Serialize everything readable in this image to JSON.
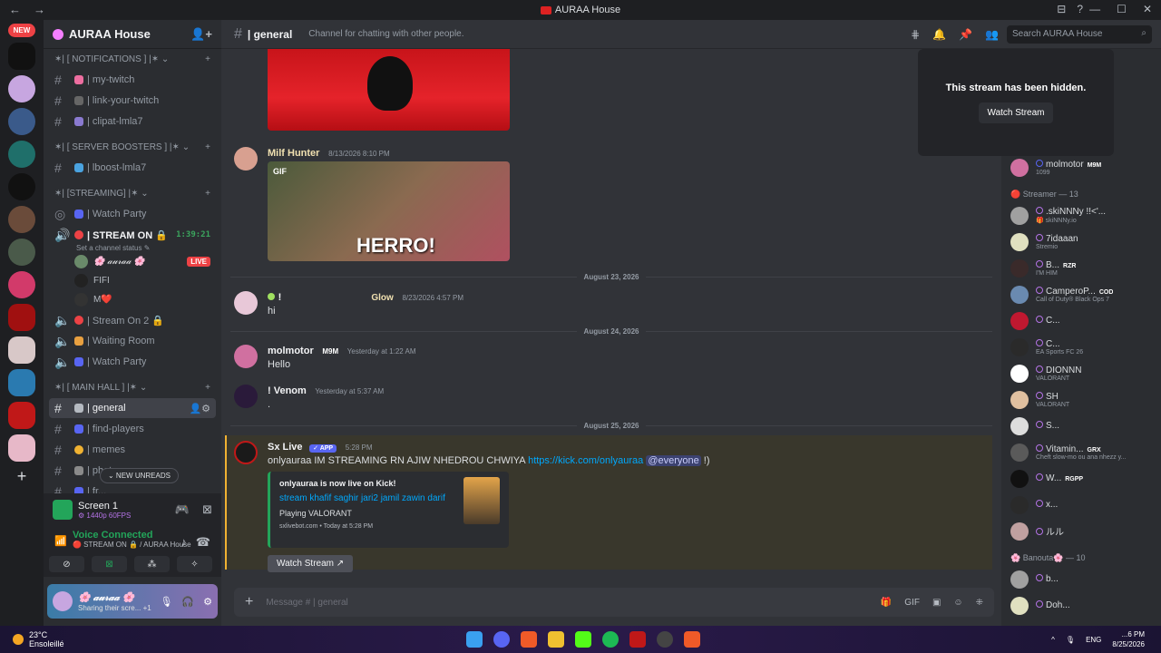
{
  "window": {
    "title": "AURAA House",
    "back": "←",
    "forward": "→",
    "minimize": "—",
    "maximize": "☐",
    "close": "✕",
    "inbox_icon": "⊟",
    "help_icon": "?"
  },
  "rail": {
    "new_badge": "NEW",
    "add_server": "+"
  },
  "server": {
    "name": "AURAA House",
    "add_icon": "👤+"
  },
  "categories": {
    "notifications": "✶| [ NOTIFICATIONS ] |✶ ⌄",
    "boosters": "✶| [ SERVER BOOSTERS ] |✶ ⌄",
    "streaming": "✶| [STREAMING] |✶ ⌄",
    "mainhall": "✶| [ MAIN HALL ] |✶ ⌄",
    "plus": "+"
  },
  "channels": {
    "my_twitch": "| my-twitch",
    "link_twitch": "| link-your-twitch",
    "clipat": "| clipat-lmla7",
    "lboost": "| lboost-lmla7",
    "watch_party": "| Watch Party",
    "stream_on": "| STREAM ON 🔒",
    "stream_timer": "1:39:21",
    "stream_status": "Set a channel status ✎",
    "stream_on2": "| Stream On 2 🔒",
    "waiting_room": "| Waiting Room",
    "watch_party2": "| Watch Party",
    "general": "| general",
    "find_players": "| find-players",
    "memes": "| memes",
    "photos": "| photos",
    "partial": "| fr..."
  },
  "voice_users": [
    {
      "name": "🌸 𝒶𝓊𝓇𝒶𝒶 🌸",
      "live": "LIVE"
    },
    {
      "name": "FIFI"
    },
    {
      "name": "M❤️"
    }
  ],
  "new_unreads": "⌄ NEW UNREADS",
  "screenshare": {
    "title": "Screen 1",
    "quality": "⚙ 1440p 60FPS"
  },
  "voice": {
    "status": "Voice Connected",
    "sub": "🔴 STREAM ON 🔒 / AURAA House",
    "btn1": "⊘",
    "btn2": "⊠",
    "btn3": "⁂",
    "btn4": "✧"
  },
  "user": {
    "name": "🌸 𝒶𝓊𝓇𝒶𝒶 🌸",
    "status": "Sharing their scre... +1",
    "mic": "🎙",
    "headset": "🎧",
    "settings": "⚙"
  },
  "header": {
    "channel": "| general",
    "topic": "Channel for chatting with other people.",
    "search_placeholder": "Search AURAA House",
    "search_icon": "⌕"
  },
  "messages": [
    {
      "author": "Milf Hunter",
      "time": "8/13/2026 8:10 PM",
      "gif_tag": "GIF",
      "gif_text": "HERRO!"
    },
    {
      "author": "! ",
      "tag": "Glow",
      "time": "8/23/2026 4:57 PM",
      "text": "hi"
    },
    {
      "author": "molmotor",
      "tag": "M9M",
      "time": "Yesterday at 1:22 AM",
      "text": "Hello"
    },
    {
      "author": "! Venom",
      "time": "Yesterday at 5:37 AM",
      "text": "."
    },
    {
      "author": "Sx Live",
      "app": "✓ APP",
      "time": "5:28 PM",
      "text": "onlyauraa IM STREAMING RN AJIW NHEDROU CHWIYA ",
      "link": "https://kick.com/onlyauraa",
      "mention": "@everyone",
      "tail": " !)",
      "embed": {
        "author": "onlyauraa is now live on Kick!",
        "title": "stream khafif saghir jari2 jamil zawin darif",
        "playing": "Playing VALORANT",
        "footer": "sxlivebot.com • Today at 5:28 PM"
      },
      "button": "Watch Stream ↗"
    }
  ],
  "dates": {
    "d1": "August 23, 2026",
    "d2": "August 24, 2026",
    "d3": "August 25, 2026"
  },
  "composer": {
    "placeholder": "Message # | general",
    "plus": "+"
  },
  "overlay": {
    "title": "This stream has been hidden.",
    "button": "Watch Stream"
  },
  "members": {
    "top": [
      {
        "name": "molmotor",
        "tag": "M9M",
        "sub": "1099"
      }
    ],
    "streamer_header": "🔴 Streamer — 13",
    "streamers": [
      {
        "name": ".skiNNNy !!<'...",
        "sub": "🎁 skiNNNy.io"
      },
      {
        "name": "7idaaan",
        "sub": "Stremio"
      },
      {
        "name": "B...",
        "tag": "RZR",
        "sub": "I'M HIM"
      },
      {
        "name": "CamperoP...",
        "tag": "COD",
        "sub": "Call of Duty® Black Ops 7"
      },
      {
        "name": "C...",
        "sub": ""
      },
      {
        "name": "C...",
        "sub": "EA Sports FC 26"
      },
      {
        "name": "DIONNN",
        "sub": "VALORANT"
      },
      {
        "name": "SH",
        "sub": "VALORANT"
      },
      {
        "name": "S...",
        "sub": ""
      },
      {
        "name": "Vitamin...",
        "tag": "GRX",
        "sub": "Cheft slow-mo ou ana nhezz y..."
      },
      {
        "name": "W...",
        "tag": "RGPP",
        "sub": ""
      },
      {
        "name": "x...",
        "sub": ""
      },
      {
        "name": "ルル",
        "sub": ""
      }
    ],
    "banouta_header": "🌸 Banouta🌸 — 10",
    "banouta": [
      {
        "name": "b..."
      },
      {
        "name": "Doh..."
      }
    ]
  },
  "taskbar": {
    "temp": "23°C",
    "weather": "Ensoleillé",
    "lang": "ENG",
    "time": "...6 PM",
    "date": "8/25/2026"
  }
}
